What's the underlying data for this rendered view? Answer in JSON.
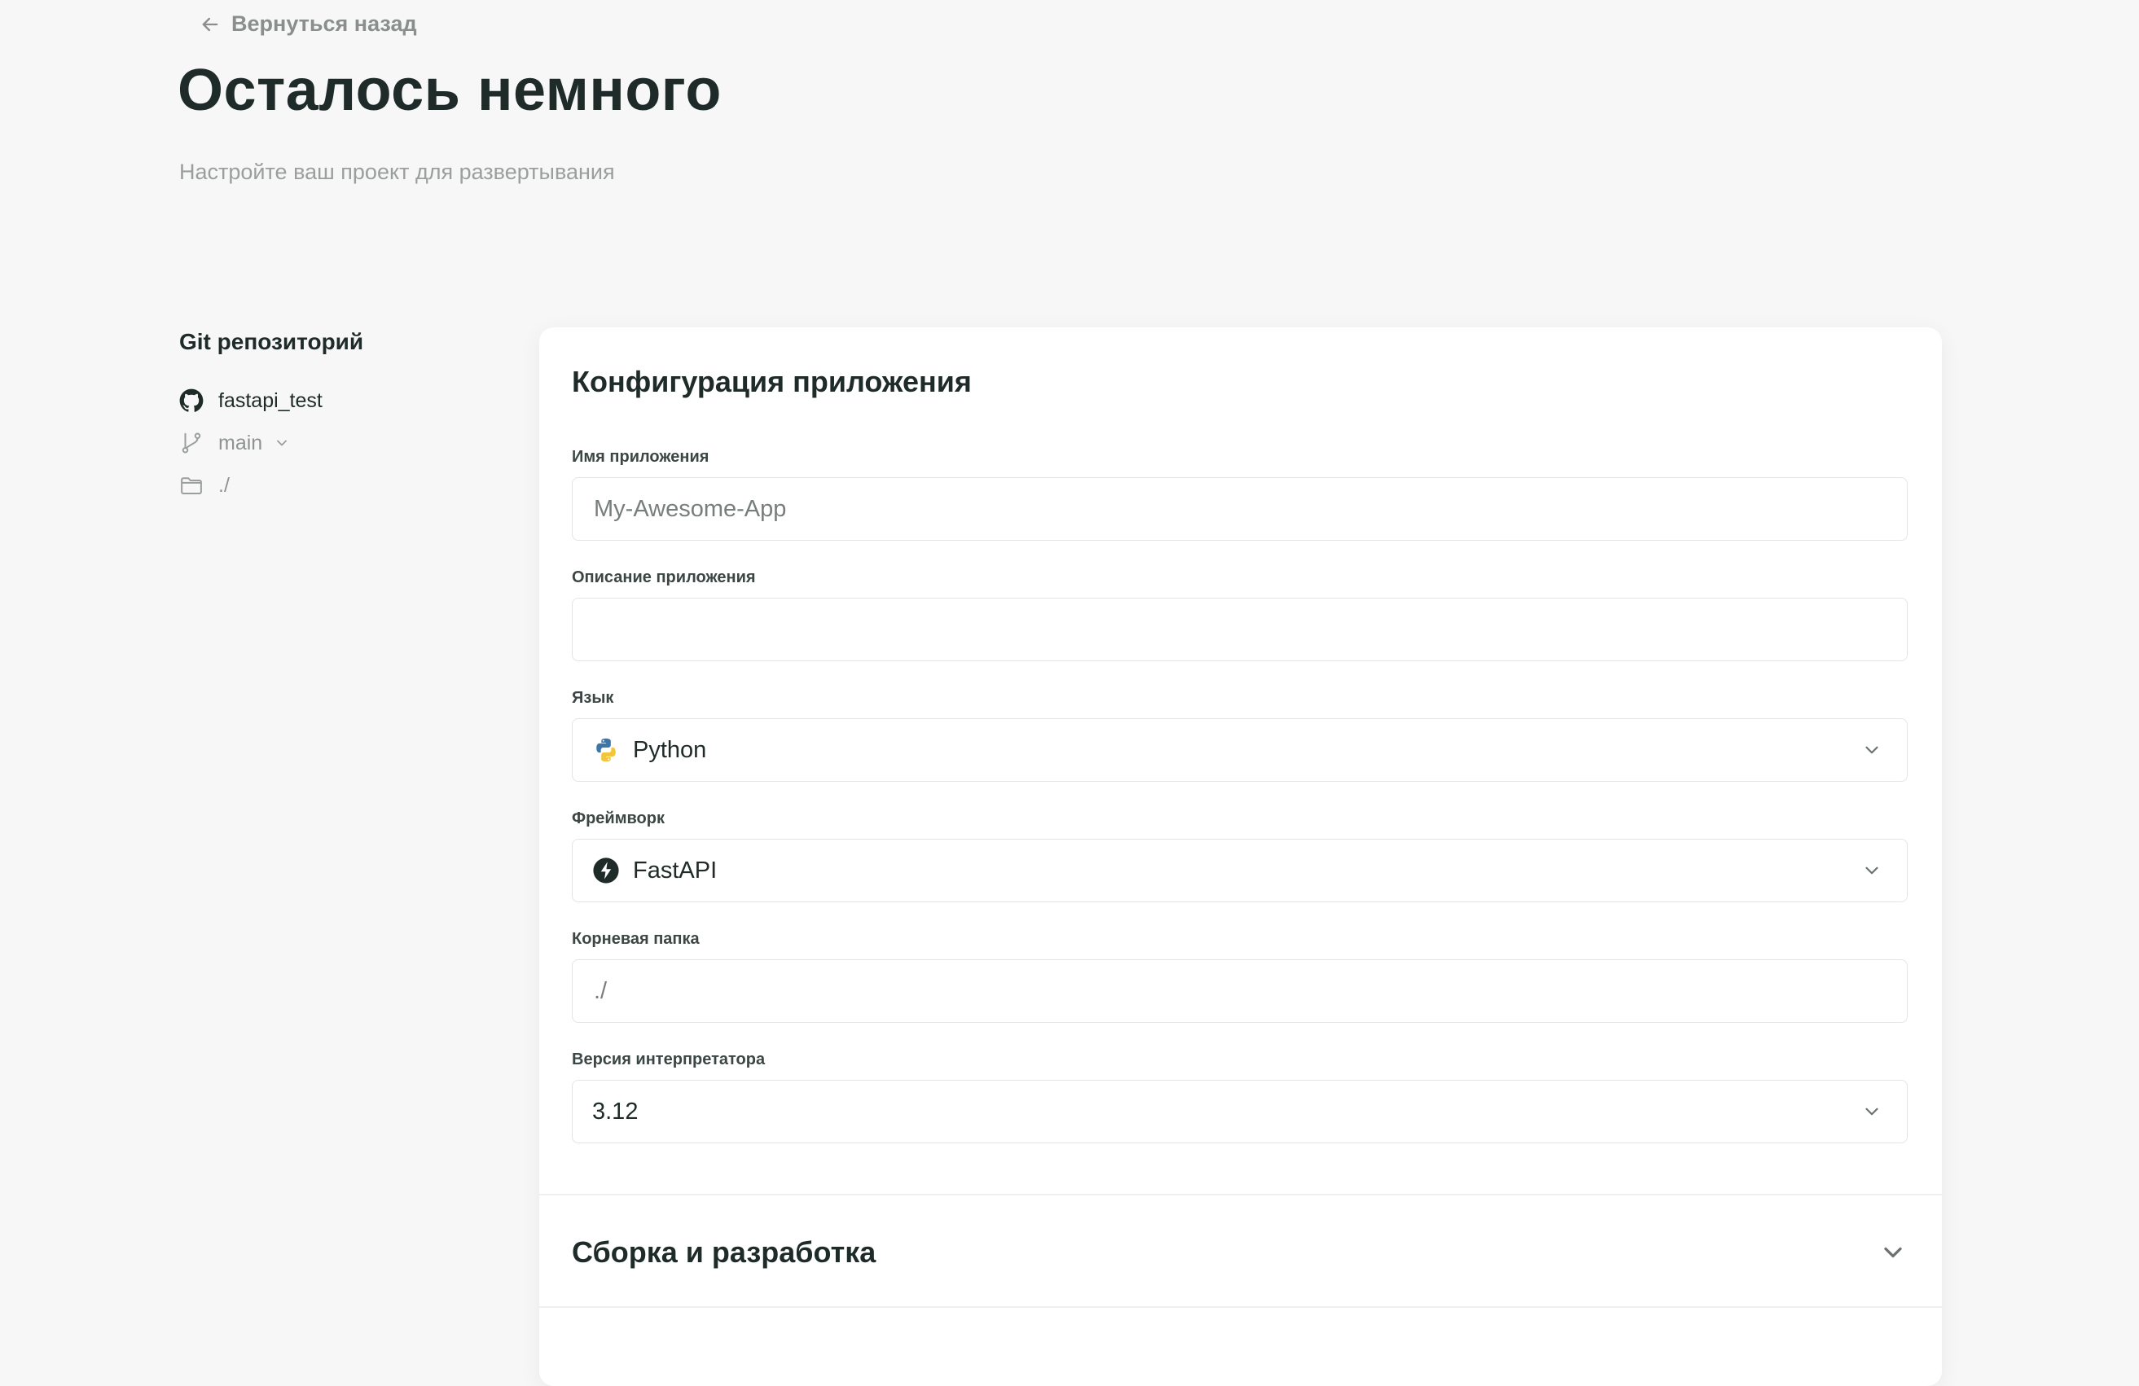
{
  "nav": {
    "back_label": "Вернуться назад"
  },
  "header": {
    "title": "Осталось немного",
    "subtitle": "Настройте ваш проект для развертывания"
  },
  "sidebar": {
    "title": "Git репозиторий",
    "repo": "fastapi_test",
    "branch": "main",
    "folder": "./"
  },
  "config": {
    "title": "Конфигурация приложения",
    "app_name": {
      "label": "Имя приложения",
      "placeholder": "My-Awesome-App",
      "value": ""
    },
    "description": {
      "label": "Описание приложения",
      "placeholder": "",
      "value": ""
    },
    "language": {
      "label": "Язык",
      "value": "Python",
      "icon": "python-icon"
    },
    "framework": {
      "label": "Фреймворк",
      "value": "FastAPI",
      "icon": "fastapi-icon"
    },
    "root_folder": {
      "label": "Корневая папка",
      "placeholder": "./",
      "value": ""
    },
    "interpreter": {
      "label": "Версия интерпретатора",
      "value": "3.12"
    }
  },
  "build_section": {
    "title": "Сборка и разработка"
  },
  "colors": {
    "background": "#f7f7f7",
    "card": "#ffffff",
    "text_primary": "#1e2b29",
    "text_muted": "#8f9392",
    "border": "#e3e5e4",
    "python_blue": "#3b77a8",
    "python_yellow": "#f2c53d",
    "fastapi_dark": "#1e2b29"
  }
}
